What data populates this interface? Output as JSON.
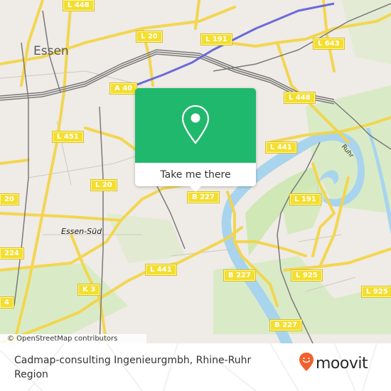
{
  "map": {
    "place_labels": {
      "city": "Essen",
      "suburb": "Essen-Süd",
      "river": "Ruhr"
    },
    "road_shields": [
      {
        "id": "l448-top",
        "label": "L 448"
      },
      {
        "id": "l20-top",
        "label": "L 20"
      },
      {
        "id": "a40",
        "label": "A 40"
      },
      {
        "id": "l191-top",
        "label": "L 191"
      },
      {
        "id": "l643",
        "label": "L 643"
      },
      {
        "id": "l448-right",
        "label": "L 448"
      },
      {
        "id": "l451",
        "label": "L 451"
      },
      {
        "id": "l441-right",
        "label": "L 441"
      },
      {
        "id": "l20-mid",
        "label": "L 20"
      },
      {
        "id": "l20-left",
        "label": "20"
      },
      {
        "id": "b227-top",
        "label": "B 227"
      },
      {
        "id": "l191-right",
        "label": "L 191"
      },
      {
        "id": "l224",
        "label": "224"
      },
      {
        "id": "l441-mid",
        "label": "L 441"
      },
      {
        "id": "k3",
        "label": "K 3"
      },
      {
        "id": "l4-left",
        "label": "4"
      },
      {
        "id": "b227-mid",
        "label": "B 227"
      },
      {
        "id": "l925-mid",
        "label": "L 925"
      },
      {
        "id": "l925-right",
        "label": "L 925"
      },
      {
        "id": "b227-bottom",
        "label": "B 227"
      }
    ],
    "attribution": "© OpenStreetMap contributors",
    "colors": {
      "land": "#efebe6",
      "park": "#cfe8b5",
      "water": "#a8d4ee",
      "road": "#f7e06a",
      "rail": "#777777",
      "motorway": "#6b6bd8"
    }
  },
  "popup": {
    "icon": "map-pin-icon",
    "action_label": "Take me there",
    "color": "#1fb86d"
  },
  "footer": {
    "place_title": "Cadmap-consulting Ingenieurgmbh, Rhine-Ruhr Region",
    "brand": {
      "name": "moovit",
      "icon": "moovit-pin-icon",
      "color": "#f2612d"
    }
  }
}
